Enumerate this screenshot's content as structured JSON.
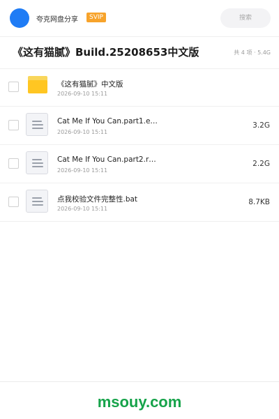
{
  "header": {
    "brand": "夸克网盘分享",
    "badge": "SVIP",
    "search_placeholder": "搜索"
  },
  "share": {
    "title": "《这有猫腻》Build.25208653中文版",
    "meta": "共 4 项 · 5.4G"
  },
  "files": [
    {
      "type": "folder",
      "name": "《这有猫腻》中文版",
      "date": "2026-09-10 15:11",
      "size": ""
    },
    {
      "type": "file",
      "name": "Cat Me If You Can.part1.e…",
      "date": "2026-09-10 15:11",
      "size": "3.2G"
    },
    {
      "type": "file",
      "name": "Cat Me If You Can.part2.r…",
      "date": "2026-09-10 15:11",
      "size": "2.2G"
    },
    {
      "type": "file",
      "name": "点我校验文件完整性.bat",
      "date": "2026-09-10 15:11",
      "size": "8.7KB"
    }
  ],
  "footer": {
    "watermark": "msouy.com"
  },
  "colors": {
    "accent": "#1f7cf5",
    "badge": "#f7a32b",
    "folder": "#ffc622",
    "watermark": "#16a34a"
  }
}
